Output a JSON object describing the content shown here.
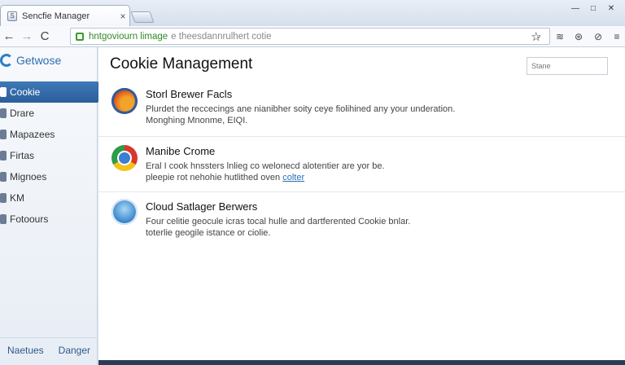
{
  "window": {
    "tab_title": "Sencfie Manager",
    "tab_close": "×",
    "controls": [
      "—",
      "□",
      "✕"
    ]
  },
  "toolbar": {
    "back": "←",
    "forward": "→",
    "reload": "C",
    "url_primary": "hntgoviourn limage",
    "url_secondary": "e theesdannrulhert cotie",
    "omni_end": "⌄",
    "star": "☆",
    "extensions": [
      "≋",
      "⊛",
      "⊘",
      "≡"
    ]
  },
  "sidebar": {
    "brand": "Getwose",
    "items": [
      {
        "label": "Cookie",
        "active": true
      },
      {
        "label": "Drare",
        "active": false
      },
      {
        "label": "Mapazees",
        "active": false
      },
      {
        "label": "Firtas",
        "active": false
      },
      {
        "label": "Mignoes",
        "active": false
      },
      {
        "label": "KM",
        "active": false
      },
      {
        "label": "Fotoours",
        "active": false
      }
    ],
    "footer": [
      "Naetues",
      "Danger"
    ]
  },
  "main": {
    "title": "Cookie Management",
    "search_placeholder": "Stane",
    "entries": [
      {
        "title": "Storl Brewer Facls",
        "line1": "Plurdet the reccecings ane nianibher soity ceye fiolihined any your underation.",
        "line2": "Monghing Mnonme, EIQI.",
        "logo": "firefox-icon"
      },
      {
        "title": "Manibe Crome",
        "line1": "Eral I cook hnssters lnlieg co welonecd alotentier are yor be.",
        "line2": "pleepie rot nehohie hutlithed  oven",
        "link": "colter",
        "logo": "chrome-icon"
      },
      {
        "title": "Cloud Satlager Berwers",
        "line1": "Four celitie geocule icras tocal hulle and dartferented Cookie bnlar.",
        "line2": "toterlie geogile istance or ciolie.",
        "logo": "safari-icon"
      }
    ]
  },
  "colors": {
    "accent": "#2f66a3",
    "url_green": "#2f8a26",
    "link": "#2a6fb8"
  }
}
